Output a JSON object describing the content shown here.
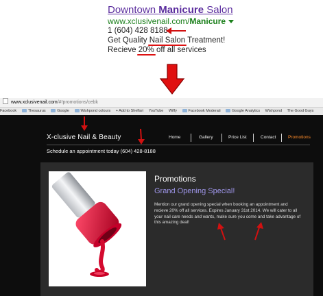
{
  "ad": {
    "title_pre": "Downtown ",
    "title_bold": "Manicure",
    "title_post": " Salon",
    "url_pre": "www.xclusivenail.com/",
    "url_bold": "Manicure",
    "phone": "1 (604) 428 8188",
    "line1_pre": "Get Quality ",
    "line1_hl": "Nail Salon",
    "line1_post": " Treatment!",
    "line2_pre": "Recieve ",
    "line2_hl": "20%",
    "line2_post": " off all services"
  },
  "browser": {
    "host": "www.xclusivenail.com",
    "path": "/#!promotions/cebk",
    "bookmarks": [
      "Facebook",
      "Thesaurus",
      "Google",
      "Wishpond colours",
      "+ Add to Shelfari",
      "YouTube",
      "Wiffy",
      "Facebook Moderati",
      "Google Analytics",
      "Wishpond",
      "The Good Guys"
    ]
  },
  "site": {
    "logo": "X-clusive Nail & Beauty",
    "nav": [
      "Home",
      "Gallery",
      "Price List",
      "Contact",
      "Promotions"
    ],
    "schedule": "Schedule an appointment today (604) 428-8188",
    "promo_heading": "Promotions",
    "promo_subheading": "Grand Opening Special!",
    "promo_body": "Mention our grand opening special when booking an appointment and recieve 20% off all services. Expires January 31st 2014. We will cater to all your nail care needs and wants, make sure you come and take advantage of this amazing deal!"
  },
  "colors": {
    "annotation_red": "#d11111",
    "nav_active": "#ff8c2a",
    "promo_sub": "#9f96ea",
    "ad_title": "#5b2d9e",
    "ad_url": "#1a7f1a"
  }
}
